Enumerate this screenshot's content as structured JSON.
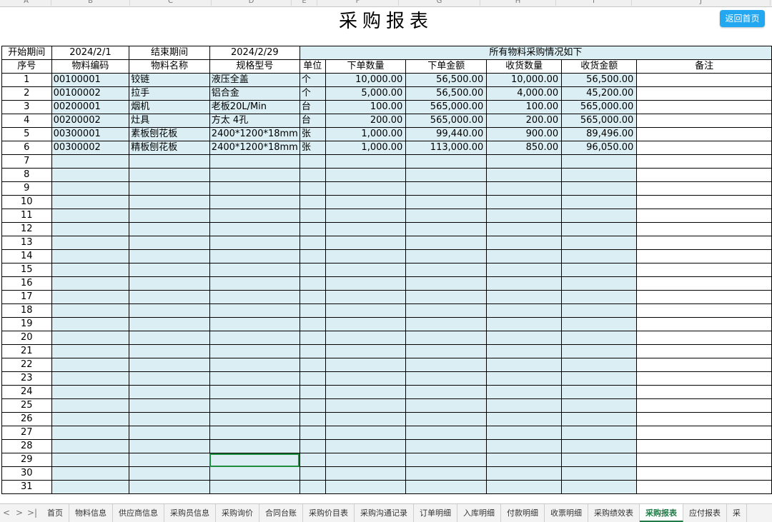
{
  "columns": [
    "A",
    "B",
    "C",
    "D",
    "E",
    "F",
    "G",
    "H",
    "I",
    "J"
  ],
  "title": "采购报表",
  "back_button": "返回首页",
  "period": {
    "start_label": "开始期间",
    "start_value": "2024/2/1",
    "end_label": "结束期间",
    "end_value": "2024/2/29",
    "summary": "所有物料采购情况如下"
  },
  "headers": [
    "序号",
    "物料编码",
    "物料名称",
    "规格型号",
    "单位",
    "下单数量",
    "下单金额",
    "收货数量",
    "收货金额",
    "备注"
  ],
  "rows": [
    [
      "1",
      "00100001",
      "铰链",
      "液压全盖",
      "个",
      "10,000.00",
      "56,500.00",
      "10,000.00",
      "56,500.00",
      ""
    ],
    [
      "2",
      "00100002",
      "拉手",
      "铝合金",
      "个",
      "5,000.00",
      "56,500.00",
      "4,000.00",
      "45,200.00",
      ""
    ],
    [
      "3",
      "00200001",
      "烟机",
      "老板20L/Min",
      "台",
      "100.00",
      "565,000.00",
      "100.00",
      "565,000.00",
      ""
    ],
    [
      "4",
      "00200002",
      "灶具",
      "方太 4孔",
      "台",
      "200.00",
      "565,000.00",
      "200.00",
      "565,000.00",
      ""
    ],
    [
      "5",
      "00300001",
      "素板刨花板",
      "2400*1200*18mm",
      "张",
      "1,000.00",
      "99,440.00",
      "900.00",
      "89,496.00",
      ""
    ],
    [
      "6",
      "00300002",
      "精板刨花板",
      "2400*1200*18mm",
      "张",
      "1,000.00",
      "113,000.00",
      "850.00",
      "96,050.00",
      ""
    ]
  ],
  "empty_row_numbers": [
    "7",
    "8",
    "9",
    "10",
    "11",
    "12",
    "13",
    "14",
    "15",
    "16",
    "17",
    "18",
    "19",
    "20",
    "21",
    "22",
    "23",
    "24",
    "25",
    "26",
    "27",
    "28",
    "29",
    "30",
    "31"
  ],
  "selected_row": "29",
  "tab_nav": [
    "<",
    ">",
    ">|"
  ],
  "sheet_tabs": [
    "首页",
    "物料信息",
    "供应商信息",
    "采购员信息",
    "采购询价",
    "合同台账",
    "采购价目表",
    "采购沟通记录",
    "订单明细",
    "入库明细",
    "付款明细",
    "收票明细",
    "采购绩效表",
    "采购报表",
    "应付报表",
    "采"
  ],
  "active_tab": "采购报表",
  "colors": {
    "fill": "#daeef3",
    "button": "#22a7f0",
    "active_tab": "#1e7b45",
    "selection": "#1e8e3e"
  }
}
